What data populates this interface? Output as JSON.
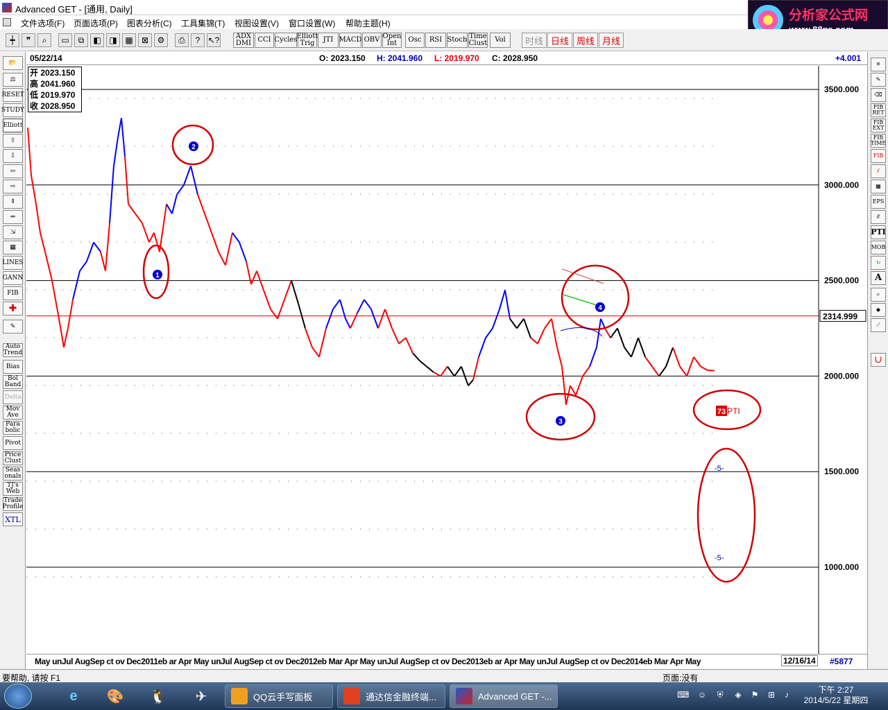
{
  "window": {
    "title": "Advanced GET - [通用, Daily]"
  },
  "logo": {
    "text_cn": "分析家公式网",
    "url": "www.88gs.com"
  },
  "menu": [
    "文件选项(F)",
    "页面选项(P)",
    "图表分析(C)",
    "工具集锦(T)",
    "视图设置(V)",
    "窗口设置(W)",
    "帮助主题(H)"
  ],
  "toolbar": {
    "indicators": [
      "ADX DMI",
      "CCI",
      "Cycles",
      "Elliott Trig",
      "JTI",
      "MACD",
      "OBV",
      "Open Int",
      "Osc",
      "RSI",
      "Stoch",
      "Time Clust",
      "Vol"
    ],
    "periods": [
      "时线",
      "日线",
      "周线",
      "月线"
    ]
  },
  "info": {
    "date": "05/22/14",
    "open": "O: 2023.150",
    "high": "H: 2041.960",
    "low": "L: 2019.970",
    "close": "C: 2028.950",
    "change": "+4.001"
  },
  "ohlc_box": [
    {
      "label": "开",
      "value": "2023.150"
    },
    {
      "label": "高",
      "value": "2041.960"
    },
    {
      "label": "低",
      "value": "2019.970"
    },
    {
      "label": "收",
      "value": "2028.950"
    }
  ],
  "price_axis": {
    "levels": [
      "3500.000",
      "3000.000",
      "2500.000",
      "2000.000",
      "1500.000",
      "1000.000"
    ],
    "current_price": "2314.999"
  },
  "left_tools": [
    "RESET",
    "STUDY",
    "Elliott",
    "LINES",
    "GANN",
    "FIB",
    "Auto Trend",
    "Bias",
    "Bol Band",
    "Delta",
    "Mov Ave",
    "Para bolic",
    "Pivot",
    "Price Clust",
    "Seas onals",
    "TJ's Web",
    "Trade Profile",
    "XTL"
  ],
  "right_tools": [
    "FIB RET",
    "FIB EXT",
    "FIB TIME",
    "FIB",
    "EPS",
    "PTI",
    "MOB",
    "A"
  ],
  "chart_labels": {
    "pti_label": "PTI",
    "pti_number": "73",
    "projection_marks": [
      "-5-",
      "-5-"
    ],
    "wave_1": "1",
    "wave_2": "2",
    "wave_3": "3",
    "wave_4": "4"
  },
  "timeline": {
    "labels": "May unJul  AugSep ct ov Dec2011eb ar Apr May unJul AugSep ct ov Dec2012eb Mar Apr May unJul AugSep ct ov Dec2013eb ar Apr May unJul AugSep ct ov Dec2014eb Mar Apr May",
    "end_date": "12/16/14",
    "bar_count": "#5877"
  },
  "status": {
    "help": "要帮助, 请按 F1",
    "page": "页面:没有"
  },
  "taskbar": {
    "apps": [
      "QQ云手写面板",
      "通达信金融终端...",
      "Advanced GET -..."
    ],
    "time": "下午 2:27",
    "date": "2014/5/22 星期四"
  },
  "colors": {
    "bull": "#0000ff",
    "bear": "#ff0000",
    "neutral": "#000000",
    "annotation": "#d00000"
  }
}
